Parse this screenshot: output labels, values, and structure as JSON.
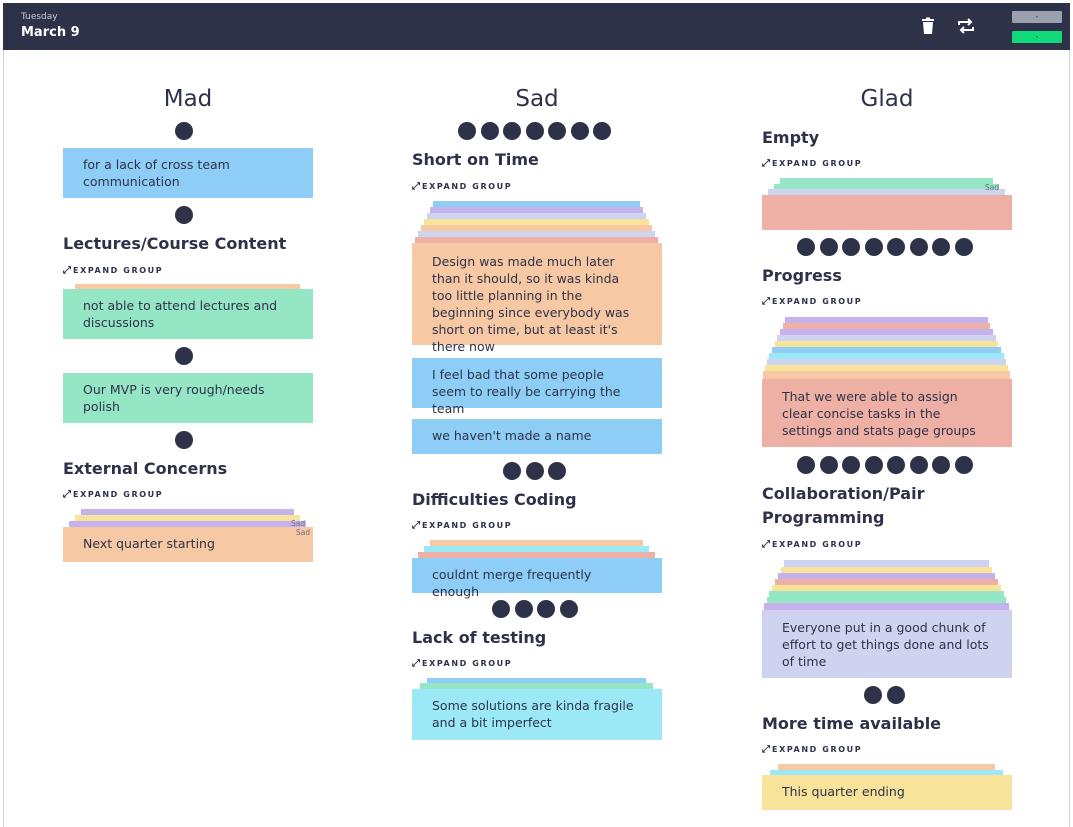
{
  "header": {
    "day": "Tuesday",
    "date": "March 9",
    "trash_icon": "trash-icon",
    "swap_icon": "repeat-icon",
    "button_top": "-",
    "button_bottom": "-"
  },
  "expand_label": "EXPAND GROUP",
  "columns": {
    "mad": {
      "title": "Mad",
      "card1": "for a lack of cross team communication",
      "group1": {
        "title": "Lectures/Course Content",
        "card": "not able to attend lectures and discussions"
      },
      "card2": "Our MVP is very rough/needs polish",
      "group2": {
        "title": "External Concerns",
        "card": "Next quarter starting",
        "tag1": "Sad",
        "tag2": "Sad"
      }
    },
    "sad": {
      "title": "Sad",
      "group1": {
        "title": "Short on Time",
        "card": "Design was made much later than it should, so it was kinda too little planning in the beginning since everybody was short on time, but at least it's there now"
      },
      "card1": "I feel bad that some people seem to really be carrying the team",
      "card2": "we haven't made a name",
      "group2": {
        "title": "Difficulties Coding",
        "card": "couldnt merge frequently enough"
      },
      "group3": {
        "title": "Lack of testing",
        "card": "Some solutions are kinda fragile and a bit imperfect"
      }
    },
    "glad": {
      "title": "Glad",
      "group1": {
        "title": "Empty",
        "tag": "Sad"
      },
      "group2": {
        "title": "Progress",
        "card": "That we were able to assign clear concise tasks in the settings and stats page groups"
      },
      "group3": {
        "title": "Collaboration/Pair Programming",
        "card": "Everyone put in a good chunk of effort to get things done and lots of time"
      },
      "group4": {
        "title": "More time available",
        "card": "This quarter ending"
      }
    }
  },
  "colors": {
    "header": "#2e3248",
    "blue": "#8ecdf5",
    "green": "#95e6c4",
    "orange": "#f6c8a4",
    "red": "#eeb0a5",
    "cyan": "#9be9f7",
    "yellow": "#f8e39b",
    "lavender": "#ced4f0",
    "purple": "#c5b1ec"
  }
}
